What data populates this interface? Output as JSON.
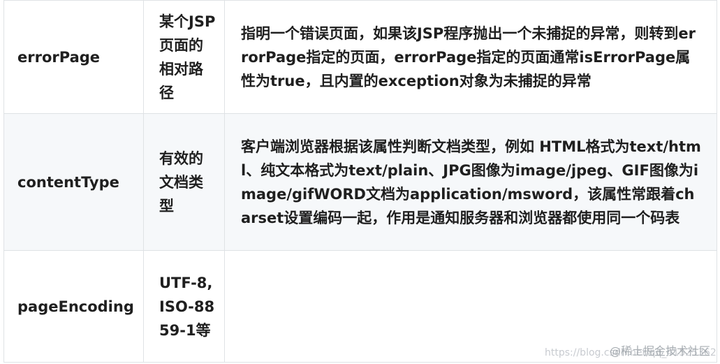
{
  "rows": [
    {
      "name": "errorPage",
      "value": "某个JSP页面的相对路径",
      "description": "指明一个错误页面，如果该JSP程序抛出一个未捕捉的异常，则转到errorPage指定的页面，errorPage指定的页面通常isErrorPage属性为true，且内置的exception对象为未捕捉的异常"
    },
    {
      "name": "contentType",
      "value": "有效的文档类型",
      "description": "客户端浏览器根据该属性判断文档类型，例如 HTML格式为text/html、纯文本格式为text/plain、JPG图像为image/jpeg、GIF图像为image/gifWORD文档为application/msword，该属性常跟着charset设置编码一起，作用是通知服务器和浏览器都使用同一个码表"
    },
    {
      "name": "pageEncoding",
      "value": "UTF-8,ISO-8859-1等",
      "description": ""
    }
  ],
  "watermark": {
    "url": "https://blog.csdn.net/qq_41525362",
    "site": "@稀土掘金技术社区"
  }
}
